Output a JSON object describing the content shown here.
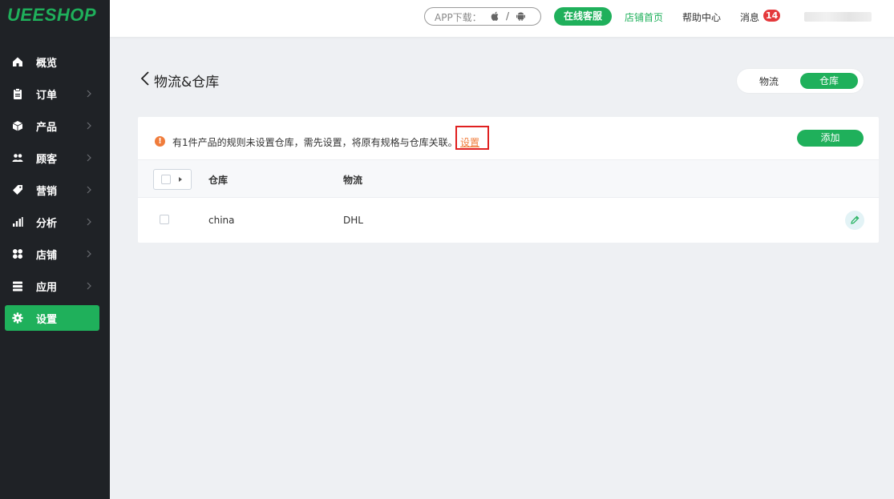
{
  "brand": {
    "logo": "UEESHOP",
    "accent": "#1fb05b"
  },
  "sidebar": {
    "items": [
      {
        "label": "概览",
        "icon": "home-icon"
      },
      {
        "label": "订单",
        "icon": "clipboard-icon"
      },
      {
        "label": "产品",
        "icon": "box-icon"
      },
      {
        "label": "顾客",
        "icon": "users-icon"
      },
      {
        "label": "营销",
        "icon": "tag-icon"
      },
      {
        "label": "分析",
        "icon": "bar-chart-icon"
      },
      {
        "label": "店铺",
        "icon": "grid-icon"
      },
      {
        "label": "应用",
        "icon": "stack-icon"
      },
      {
        "label": "设置",
        "icon": "gear-icon",
        "active": true
      }
    ]
  },
  "topbar": {
    "app_download": "APP下载：",
    "app_separator": "/",
    "online_service": "在线客服",
    "store_home": "店铺首页",
    "help_center": "帮助中心",
    "messages": "消息",
    "message_count": "14"
  },
  "page": {
    "title": "物流&仓库",
    "tabs": [
      "物流",
      "仓库"
    ],
    "active_tab": "仓库"
  },
  "notice": {
    "text": "有1件产品的规则未设置仓库，需先设置，将原有规格与仓库关联。",
    "link": "设置",
    "color": "#f07c3b"
  },
  "actions": {
    "add": "添加"
  },
  "table": {
    "columns": [
      "仓库",
      "物流"
    ],
    "rows": [
      {
        "warehouse": "china",
        "logistics": "DHL"
      }
    ]
  }
}
